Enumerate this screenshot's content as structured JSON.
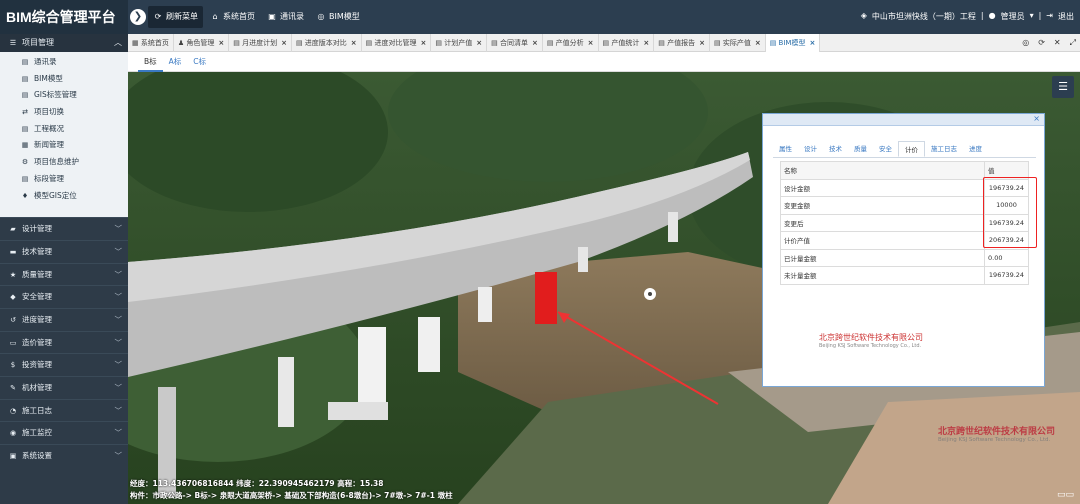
{
  "app": {
    "title": "BIM综合管理平台"
  },
  "top_nav": [
    {
      "label": "刷新菜单",
      "icon": "refresh-icon"
    },
    {
      "label": "系统首页",
      "icon": "home-icon"
    },
    {
      "label": "通讯录",
      "icon": "contacts-icon"
    },
    {
      "label": "BIM模型",
      "icon": "globe-icon"
    }
  ],
  "top_right": {
    "project": "中山市坦洲快线（一期）工程",
    "user": "管理员",
    "logout": "退出"
  },
  "sidebar": {
    "header": "项目管理",
    "sub_items": [
      {
        "label": "通讯录",
        "icon": "file-icon"
      },
      {
        "label": "BIM模型",
        "icon": "file-icon"
      },
      {
        "label": "GIS标签管理",
        "icon": "file-icon"
      },
      {
        "label": "项目切换",
        "icon": "switch-icon"
      },
      {
        "label": "工程概况",
        "icon": "file-icon"
      },
      {
        "label": "新闻管理",
        "icon": "news-icon"
      },
      {
        "label": "项目信息维护",
        "icon": "gears-icon"
      },
      {
        "label": "标段管理",
        "icon": "file-icon"
      },
      {
        "label": "模型GIS定位",
        "icon": "map-marker-icon"
      }
    ],
    "groups": [
      {
        "label": "设计管理",
        "icon": "car-icon"
      },
      {
        "label": "技术管理",
        "icon": "briefcase-icon"
      },
      {
        "label": "质量管理",
        "icon": "star-icon"
      },
      {
        "label": "安全管理",
        "icon": "shield-icon"
      },
      {
        "label": "进度管理",
        "icon": "history-icon"
      },
      {
        "label": "造价管理",
        "icon": "money-icon"
      },
      {
        "label": "投资管理",
        "icon": "dollar-icon"
      },
      {
        "label": "机材管理",
        "icon": "wrench-icon"
      },
      {
        "label": "施工日志",
        "icon": "clock-icon"
      },
      {
        "label": "施工监控",
        "icon": "monitor-icon"
      },
      {
        "label": "系统设置",
        "icon": "settings-icon"
      }
    ]
  },
  "tabs": [
    {
      "label": "系统首页"
    },
    {
      "label": "角色管理"
    },
    {
      "label": "月进度计划"
    },
    {
      "label": "进度版本对比"
    },
    {
      "label": "进度对比管理"
    },
    {
      "label": "计划产值"
    },
    {
      "label": "合同清单"
    },
    {
      "label": "产值分析"
    },
    {
      "label": "产值统计"
    },
    {
      "label": "产值报告"
    },
    {
      "label": "实际产值"
    },
    {
      "label": "BIM模型"
    }
  ],
  "sub_tabs": [
    {
      "label": "B标"
    },
    {
      "label": "A标"
    },
    {
      "label": "C标"
    }
  ],
  "viewer": {
    "coords": "经度：113.436706816844 纬度：22.390945462179 高程：15.38",
    "component": "构件：市政公路-> B标-> 泉眼大道高架桥-> 基础及下部构造(6-8墩台)-> 7#墩-> 7#-1 墩柱",
    "watermark": {
      "cn": "北京跨世纪软件技术有限公司",
      "en": "Beijing KSJ Software Technology Co., Ltd."
    }
  },
  "panel": {
    "tabs": [
      "属性",
      "设计",
      "技术",
      "质量",
      "安全",
      "计价",
      "施工日志",
      "进度"
    ],
    "active_tab": "计价",
    "headers": [
      "名称",
      "值"
    ],
    "rows": [
      {
        "name": "设计金额",
        "value": "196739.24"
      },
      {
        "name": "变更金额",
        "value": "10000"
      },
      {
        "name": "变更后",
        "value": "196739.24"
      },
      {
        "name": "计价产值",
        "value": "206739.24"
      },
      {
        "name": "已计量金额",
        "value": "0.00"
      },
      {
        "name": "未计量金额",
        "value": "196739.24"
      }
    ]
  },
  "colors": {
    "topbar": "#2c3e50",
    "sidebar": "#2e3b48",
    "highlight": "#e22222",
    "pier": "#e11d1d"
  }
}
